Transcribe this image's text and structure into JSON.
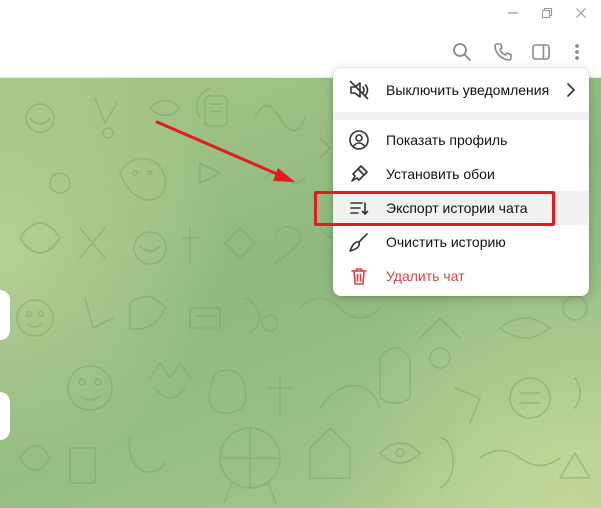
{
  "window": {
    "controls": [
      "minimize-icon",
      "maximize-icon",
      "close-icon"
    ]
  },
  "header": {
    "icons": [
      "search-icon",
      "phone-icon",
      "sidebar-toggle-icon",
      "more-vertical-icon"
    ]
  },
  "menu": {
    "items": [
      {
        "label": "Выключить уведомления",
        "icon": "mute-icon",
        "has_submenu": true
      },
      {
        "label": "Показать профиль",
        "icon": "profile-icon"
      },
      {
        "label": "Установить обои",
        "icon": "brush-icon"
      },
      {
        "label": "Экспорт истории чата",
        "icon": "export-icon",
        "highlighted": true
      },
      {
        "label": "Очистить историю",
        "icon": "broom-icon"
      },
      {
        "label": "Удалить чат",
        "icon": "trash-icon",
        "danger": true
      }
    ]
  },
  "colors": {
    "danger": "#d9414a",
    "annotation": "#e01e1e",
    "chat_background": "#9dc288"
  }
}
